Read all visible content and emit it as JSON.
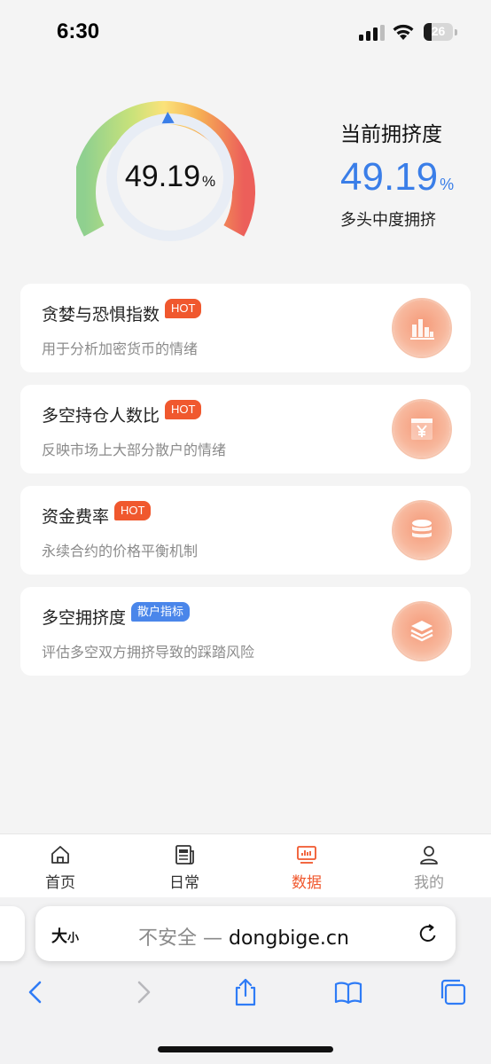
{
  "status_bar": {
    "time": "6:30",
    "battery_level": "26",
    "battery_fraction": 0.26
  },
  "gauge": {
    "value": "49.19",
    "unit": "%",
    "fraction": 0.4919
  },
  "summary": {
    "title": "当前拥挤度",
    "value": "49.19",
    "unit": "%",
    "status": "多头中度拥挤"
  },
  "cards": [
    {
      "title": "贪婪与恐惧指数",
      "badge": "HOT",
      "description": "用于分析加密货币的情绪",
      "icon": "bar-chart-icon"
    },
    {
      "title": "多空持仓人数比",
      "badge": "HOT",
      "description": "反映市场上大部分散户的情绪",
      "icon": "yuan-ticket-icon"
    },
    {
      "title": "资金费率",
      "badge": "HOT",
      "description": "永续合约的价格平衡机制",
      "icon": "database-icon"
    },
    {
      "title": "多空拥挤度",
      "badge": "散户指标",
      "description": "评估多空双方拥挤导致的踩踏风险",
      "icon": "layers-icon"
    }
  ],
  "tabbar": {
    "items": [
      {
        "label": "首页",
        "icon": "home-icon"
      },
      {
        "label": "日常",
        "icon": "newspaper-icon"
      },
      {
        "label": "数据",
        "icon": "data-screen-icon"
      },
      {
        "label": "我的",
        "icon": "user-icon"
      }
    ],
    "active_index": 2
  },
  "browser": {
    "text_size_big": "大",
    "text_size_small": "小",
    "security": "不安全 — ",
    "host": "dongbige.cn"
  },
  "colors": {
    "accent": "#f0582e",
    "primary_blue": "#3a7ee8",
    "badge_blue": "#4a86ea"
  }
}
